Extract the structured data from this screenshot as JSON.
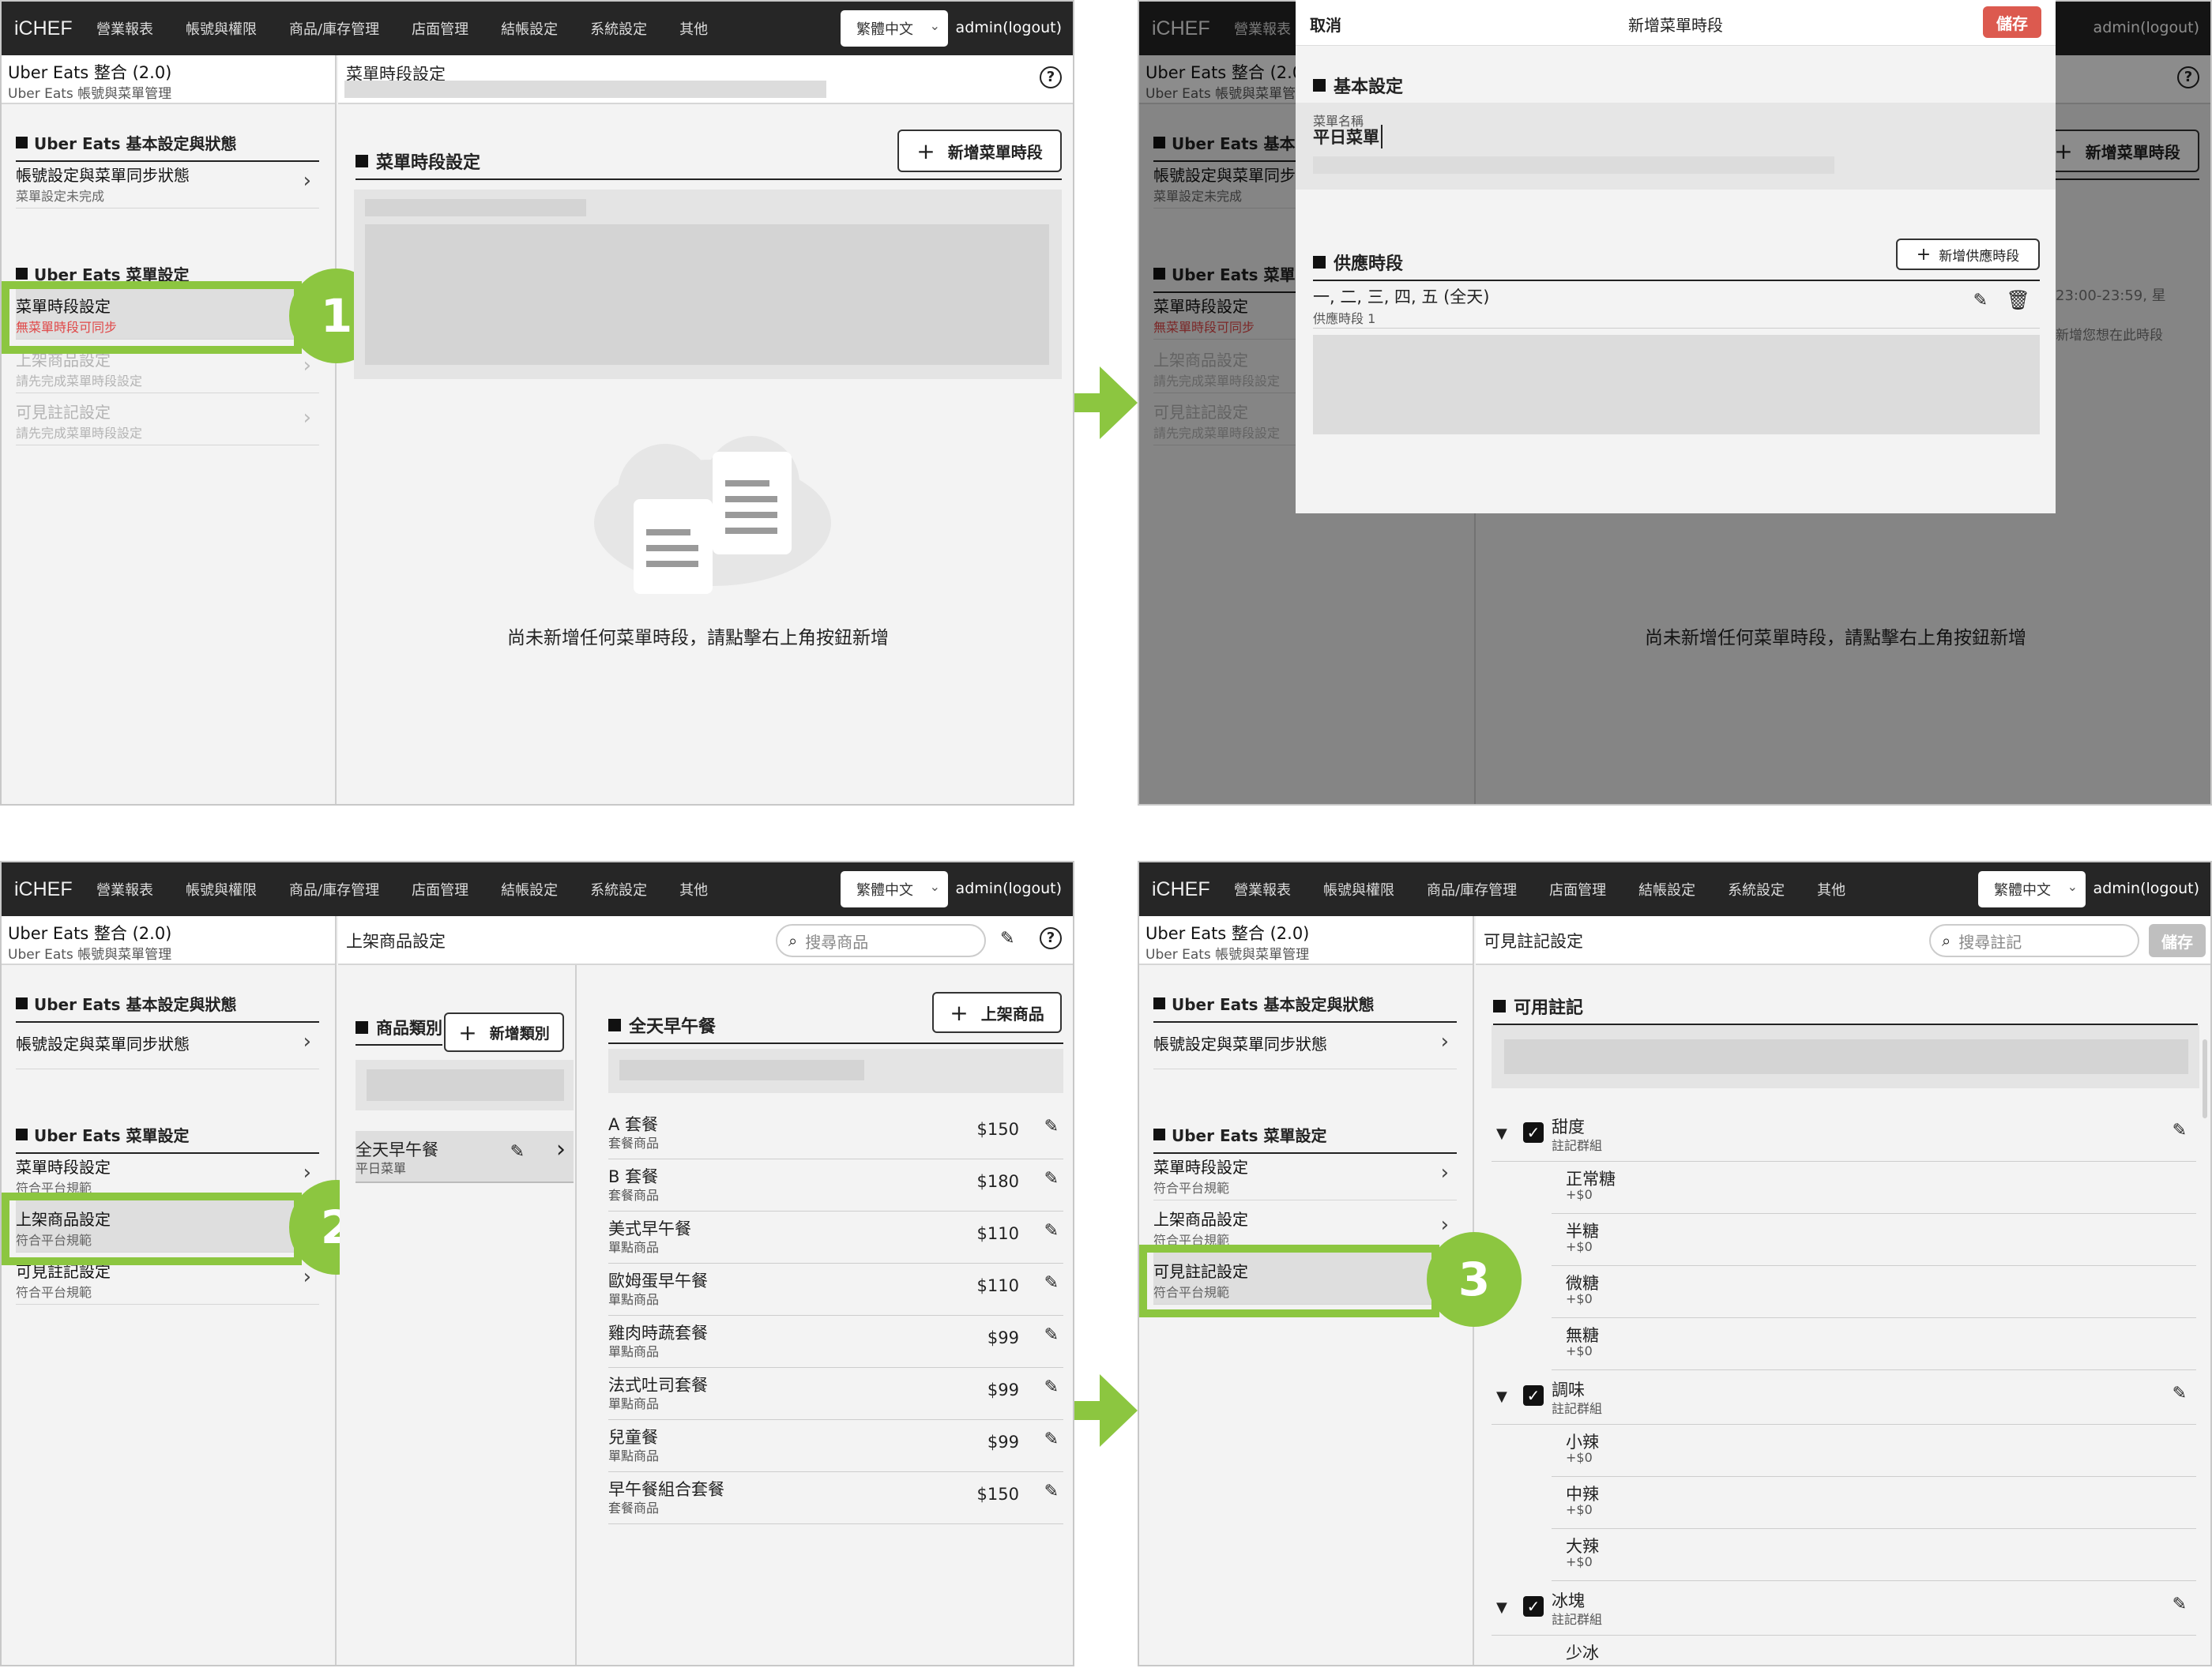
{
  "app": {
    "logo": "iCHEF",
    "nav": [
      "營業報表",
      "帳號與權限",
      "商品/庫存管理",
      "店面管理",
      "結帳設定",
      "系統設定",
      "其他"
    ],
    "language": "繁體中文",
    "admin": "admin(logout)"
  },
  "sidebar": {
    "title": "Uber Eats 整合 (2.0)",
    "subtitle": "Uber Eats 帳號與菜單管理",
    "section_basic": "Uber Eats 基本設定與狀態",
    "section_menu": "Uber Eats 菜單設定",
    "account_item": "帳號設定與菜單同步狀態",
    "account_sub_incomplete": "菜單設定未完成",
    "menu_time": "菜單時段設定",
    "menu_time_sub_warn": "無菜單時段可同步",
    "listing": "上架商品設定",
    "listing_sub_disabled": "請先完成菜單時段設定",
    "notes": "可見註記設定",
    "notes_sub_disabled": "請先完成菜單時段設定",
    "compliant": "符合平台規範"
  },
  "steps": [
    "1",
    "2",
    "3"
  ],
  "panel1": {
    "header": "菜單時段設定",
    "section": "菜單時段設定",
    "add_button": "新增菜單時段",
    "empty": "尚未新增任何菜單時段，請點擊右上角按鈕新增"
  },
  "modal": {
    "cancel": "取消",
    "title": "新增菜單時段",
    "save": "儲存",
    "basic": "基本設定",
    "name_label": "菜單名稱",
    "name_value": "平日菜單",
    "supply": "供應時段",
    "add_supply": "新增供應時段",
    "slot_days": "一, 二, 三, 四, 五 (全天)",
    "slot_name": "供應時段 1",
    "bg_time": "23:00-23:59, 星",
    "bg_hint": "新增您想在此時段"
  },
  "panel3": {
    "header": "上架商品設定",
    "search_placeholder": "搜尋商品",
    "cat_section": "商品類別",
    "add_category": "新增類別",
    "category": "全天早午餐",
    "category_sub": "平日菜單",
    "list_section": "全天早午餐",
    "add_product": "上架商品",
    "products": [
      {
        "name": "A 套餐",
        "type": "套餐商品",
        "price": "$150"
      },
      {
        "name": "B 套餐",
        "type": "套餐商品",
        "price": "$180"
      },
      {
        "name": "美式早午餐",
        "type": "單點商品",
        "price": "$110"
      },
      {
        "name": "歐姆蛋早午餐",
        "type": "單點商品",
        "price": "$110"
      },
      {
        "name": "雞肉時蔬套餐",
        "type": "單點商品",
        "price": "$99"
      },
      {
        "name": "法式吐司套餐",
        "type": "單點商品",
        "price": "$99"
      },
      {
        "name": "兒童餐",
        "type": "單點商品",
        "price": "$99"
      },
      {
        "name": "早午餐組合套餐",
        "type": "套餐商品",
        "price": "$150"
      }
    ]
  },
  "panel4": {
    "header": "可見註記設定",
    "search_placeholder": "搜尋註記",
    "save": "儲存",
    "section": "可用註記",
    "group_type": "註記群組",
    "groups": [
      {
        "name": "甜度",
        "options": [
          {
            "name": "正常糖",
            "price": "+$0"
          },
          {
            "name": "半糖",
            "price": "+$0"
          },
          {
            "name": "微糖",
            "price": "+$0"
          },
          {
            "name": "無糖",
            "price": "+$0"
          }
        ]
      },
      {
        "name": "調味",
        "options": [
          {
            "name": "小辣",
            "price": "+$0"
          },
          {
            "name": "中辣",
            "price": "+$0"
          },
          {
            "name": "大辣",
            "price": "+$0"
          }
        ]
      },
      {
        "name": "冰塊",
        "options": [
          {
            "name": "少冰",
            "price": ""
          }
        ]
      }
    ]
  },
  "colors": {
    "accent": "#8cc640",
    "save": "#dc5a4f",
    "topbar": "#262626",
    "warn": "#e04848"
  }
}
